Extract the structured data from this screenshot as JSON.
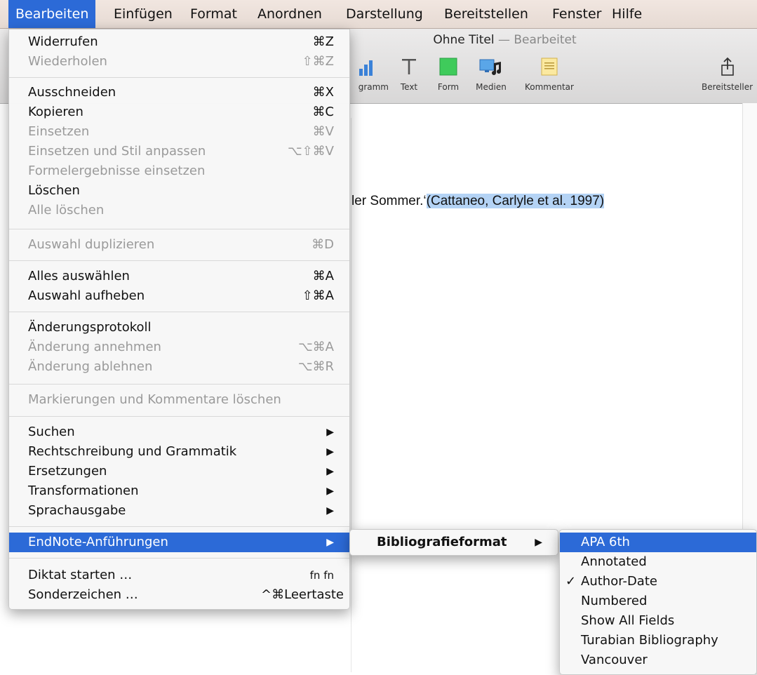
{
  "menubar": {
    "items": [
      "Bearbeiten",
      "Einfügen",
      "Format",
      "Anordnen",
      "Darstellung",
      "Bereitstellen",
      "Fenster",
      "Hilfe"
    ]
  },
  "window": {
    "title": "Ohne Titel",
    "title_sep": " — ",
    "title_status": "Bearbeitet",
    "toolbar": {
      "diagram_label": "gramm",
      "text_label": "Text",
      "form_label": "Form",
      "media_label": "Medien",
      "comment_label": "Kommentar",
      "share_label": "Bereitsteller"
    },
    "document": {
      "text_visible": "ler Sommer.‘",
      "citation": "(Cattaneo, Carlyle et al. 1997)"
    }
  },
  "edit_menu": {
    "items": [
      {
        "label": "Widerrufen",
        "shortcut": "⌘Z",
        "enabled": true
      },
      {
        "label": "Wiederholen",
        "shortcut": "⇧⌘Z",
        "enabled": false
      },
      {
        "label": "Ausschneiden",
        "shortcut": "⌘X",
        "enabled": true
      },
      {
        "label": "Kopieren",
        "shortcut": "⌘C",
        "enabled": true
      },
      {
        "label": "Einsetzen",
        "shortcut": "⌘V",
        "enabled": false
      },
      {
        "label": "Einsetzen und Stil anpassen",
        "shortcut": "⌥⇧⌘V",
        "enabled": false
      },
      {
        "label": "Formelergebnisse einsetzen",
        "shortcut": "",
        "enabled": false
      },
      {
        "label": "Löschen",
        "shortcut": "",
        "enabled": true
      },
      {
        "label": "Alle löschen",
        "shortcut": "",
        "enabled": false
      },
      {
        "label": "Auswahl duplizieren",
        "shortcut": "⌘D",
        "enabled": false
      },
      {
        "label": "Alles auswählen",
        "shortcut": "⌘A",
        "enabled": true
      },
      {
        "label": "Auswahl aufheben",
        "shortcut": "⇧⌘A",
        "enabled": true
      },
      {
        "label": "Änderungsprotokoll",
        "shortcut": "",
        "enabled": true
      },
      {
        "label": "Änderung annehmen",
        "shortcut": "⌥⌘A",
        "enabled": false
      },
      {
        "label": "Änderung ablehnen",
        "shortcut": "⌥⌘R",
        "enabled": false
      },
      {
        "label": "Markierungen und Kommentare löschen",
        "shortcut": "",
        "enabled": false
      },
      {
        "label": "Suchen",
        "shortcut": "▶",
        "enabled": true
      },
      {
        "label": "Rechtschreibung und Grammatik",
        "shortcut": "▶",
        "enabled": true
      },
      {
        "label": "Ersetzungen",
        "shortcut": "▶",
        "enabled": true
      },
      {
        "label": "Transformationen",
        "shortcut": "▶",
        "enabled": true
      },
      {
        "label": "Sprachausgabe",
        "shortcut": "▶",
        "enabled": true
      },
      {
        "label": "EndNote-Anführungen",
        "shortcut": "▶",
        "enabled": true
      },
      {
        "label": "Diktat starten …",
        "shortcut": "fn fn",
        "enabled": true
      },
      {
        "label": "Sonderzeichen …",
        "shortcut": "^⌘Leertaste",
        "enabled": true
      }
    ]
  },
  "endnote_submenu": {
    "items": [
      {
        "label": "Bibliografieformat",
        "shortcut": "▶"
      }
    ]
  },
  "bibliography_submenu": {
    "items": [
      {
        "label": "APA 6th",
        "checked": false
      },
      {
        "label": "Annotated",
        "checked": false
      },
      {
        "label": "Author-Date",
        "checked": true
      },
      {
        "label": "Numbered",
        "checked": false
      },
      {
        "label": "Show All Fields",
        "checked": false
      },
      {
        "label": "Turabian Bibliography",
        "checked": false
      },
      {
        "label": "Vancouver",
        "checked": false
      }
    ],
    "check_mark": "✓"
  },
  "colors": {
    "highlight": "#2c6ad7",
    "selection": "#b4d3f5",
    "form_icon": "#3fcb5b"
  }
}
